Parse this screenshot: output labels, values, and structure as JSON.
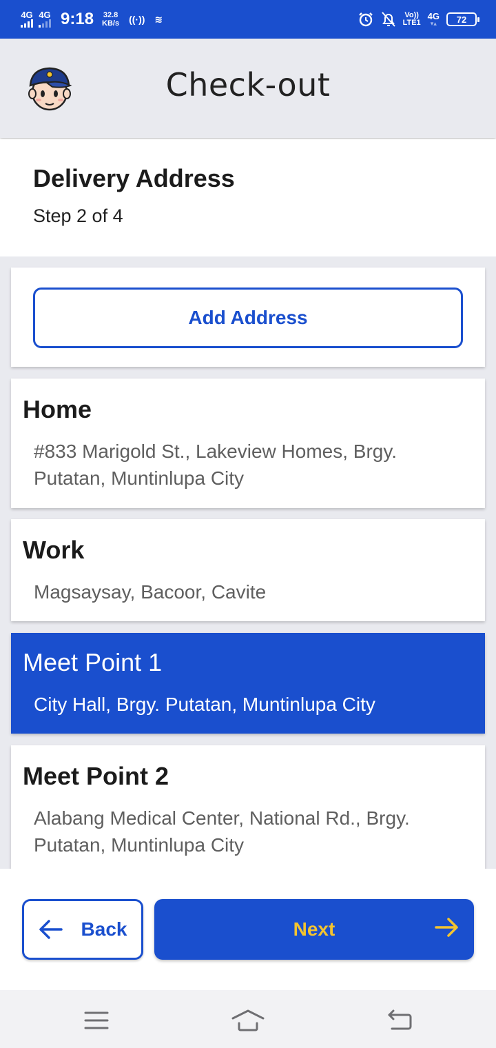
{
  "status_bar": {
    "network_1": "4G",
    "network_2": "4G",
    "time": "9:18",
    "speed_value": "32.8",
    "speed_unit": "KB/s",
    "volte": "Vo))",
    "lte": "LTE1",
    "network_3": "4G",
    "battery": "72"
  },
  "header": {
    "title": "Check-out"
  },
  "step": {
    "title": "Delivery Address",
    "subtitle": "Step 2 of 4"
  },
  "add_address_label": "Add Address",
  "addresses": [
    {
      "name": "Home",
      "address": "#833 Marigold St., Lakeview Homes, Brgy. Putatan, Muntinlupa City",
      "selected": false
    },
    {
      "name": "Work",
      "address": "Magsaysay, Bacoor, Cavite",
      "selected": false
    },
    {
      "name": "Meet Point 1",
      "address": "City Hall, Brgy. Putatan, Muntinlupa City",
      "selected": true
    },
    {
      "name": "Meet Point 2",
      "address": "Alabang Medical Center, National Rd., Brgy. Putatan, Muntinlupa City",
      "selected": false
    }
  ],
  "footer": {
    "back_label": "Back",
    "next_label": "Next"
  },
  "colors": {
    "primary": "#1a4fce",
    "accent": "#f4c430",
    "background": "#e9eaef"
  },
  "icons": {
    "back": "arrow-left-icon",
    "next": "arrow-right-icon",
    "menu": "menu-icon",
    "home": "home-icon",
    "return": "return-icon"
  }
}
